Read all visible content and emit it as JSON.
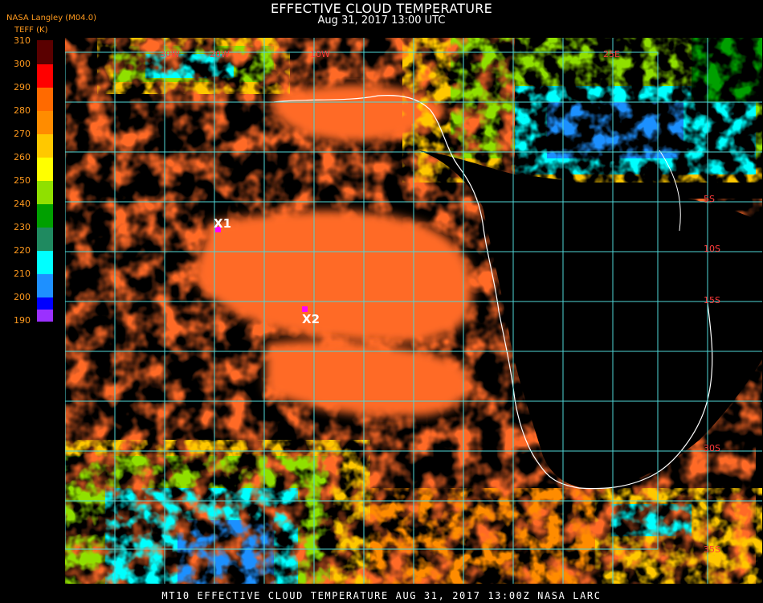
{
  "header": {
    "title": "EFFECTIVE CLOUD TEMPERATURE",
    "subtitle": "Aug 31, 2017 13:00 UTC",
    "producer": "NASA Langley (M04.0)",
    "units": "TEFF (K)"
  },
  "legend": {
    "ticks": [
      "310",
      "300",
      "290",
      "280",
      "270",
      "260",
      "250",
      "240",
      "230",
      "220",
      "210",
      "200",
      "190"
    ],
    "colors": [
      "#5a0000",
      "#ff0000",
      "#ff6a00",
      "#ff8c00",
      "#ffc800",
      "#ffff00",
      "#90e000",
      "#00a000",
      "#1f8a60",
      "#00ffff",
      "#1e90ff",
      "#0000ff",
      "#9b30ff"
    ]
  },
  "map_labels": {
    "lat_lon": [
      "30W",
      "20W",
      "10W",
      "25E",
      "5S",
      "10S",
      "15S",
      "30S",
      "35S"
    ],
    "markers": [
      {
        "label": "X1",
        "color": "#ff00ff"
      },
      {
        "label": "X2",
        "color": "#ff00ff"
      }
    ],
    "colors": {
      "grid": "#4fd6d6",
      "coast": "#ffffff",
      "stratocumulus": "#ff6a28",
      "clear": "#000000"
    }
  },
  "footer": {
    "text": "MT10  EFFECTIVE CLOUD TEMPERATURE   AUG 31, 2017 13:00Z   NASA LARC"
  }
}
